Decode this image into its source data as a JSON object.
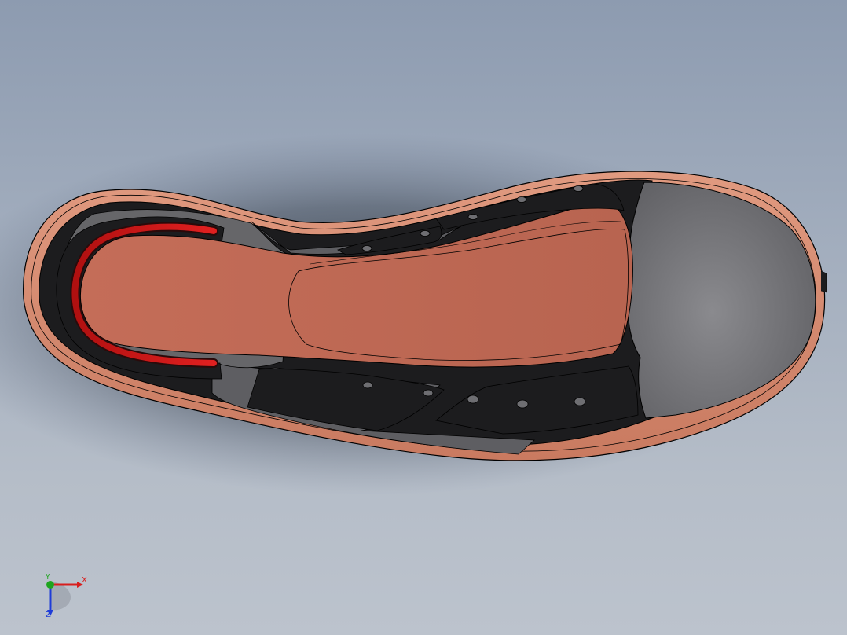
{
  "window": {
    "title": ""
  },
  "scene": {
    "background_top": "#8d9bb0",
    "background_bottom": "#bcc3cd",
    "colors": {
      "sole": "#d98a6e",
      "insole": "#c06a55",
      "upper_dark": "#1c1c1e",
      "upper_gray": "#6e6e72",
      "toe_cap": "#757578",
      "heel_stripe": "#c81414",
      "edge_line": "#000000"
    },
    "model": {
      "name": "shoe-model"
    }
  },
  "triad": {
    "x_label": "X",
    "y_label": "Y",
    "z_label": "Z",
    "x_color": "#d81e1e",
    "y_color": "#1ea51e",
    "z_color": "#1e3cd8"
  }
}
